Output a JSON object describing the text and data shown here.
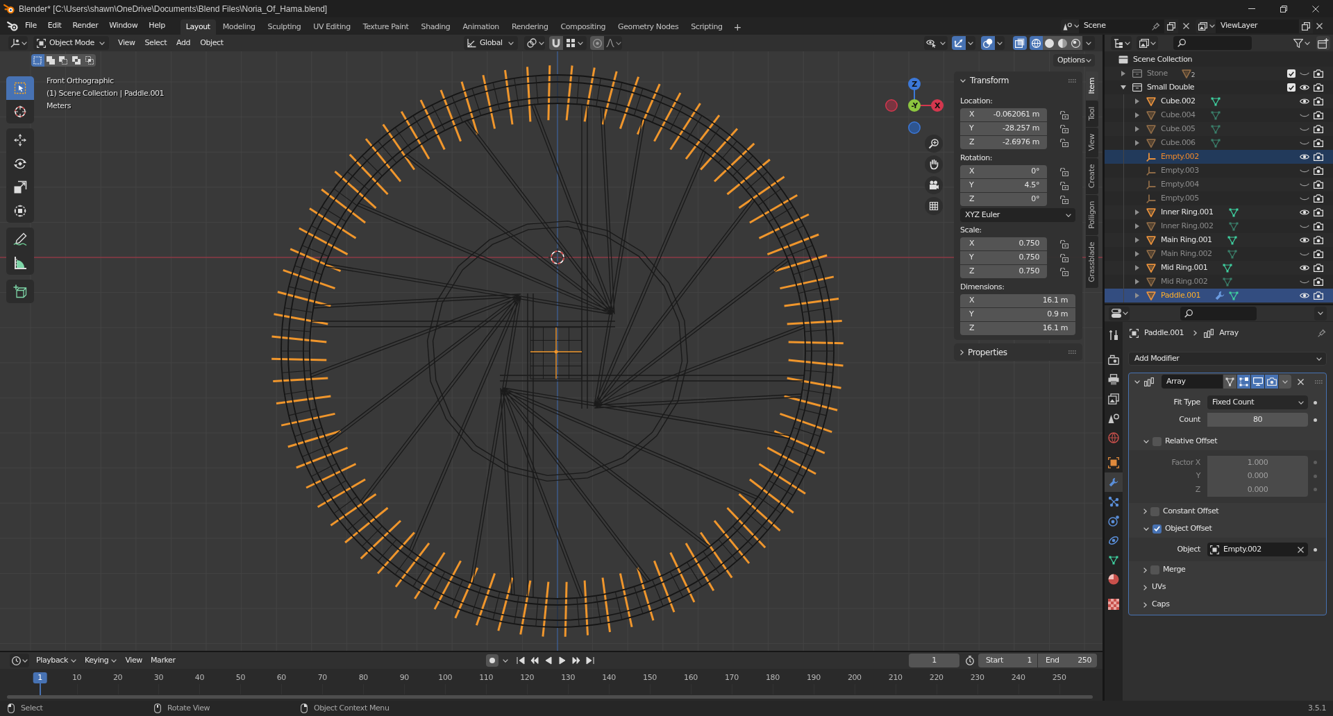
{
  "window": {
    "title": "Blender* [C:\\Users\\shawn\\OneDrive\\Documents\\Blend Files\\Noria_Of_Hama.blend]"
  },
  "top_bar": {
    "menus": [
      "File",
      "Edit",
      "Render",
      "Window",
      "Help"
    ],
    "workspaces": [
      {
        "label": "Layout",
        "selected": true
      },
      {
        "label": "Modeling",
        "selected": false
      },
      {
        "label": "Sculpting",
        "selected": false
      },
      {
        "label": "UV Editing",
        "selected": false
      },
      {
        "label": "Texture Paint",
        "selected": false
      },
      {
        "label": "Shading",
        "selected": false
      },
      {
        "label": "Animation",
        "selected": false
      },
      {
        "label": "Rendering",
        "selected": false
      },
      {
        "label": "Compositing",
        "selected": false
      },
      {
        "label": "Geometry Nodes",
        "selected": false
      },
      {
        "label": "Scripting",
        "selected": false
      }
    ],
    "add_workspace": "+",
    "scene": "Scene",
    "view_layer": "ViewLayer"
  },
  "viewport": {
    "mode": "Object Mode",
    "menus": [
      "View",
      "Select",
      "Add",
      "Object"
    ],
    "orientation": "Global",
    "overlay_toggles": [
      {
        "kind": "visibility",
        "on": false
      },
      {
        "kind": "gizmos",
        "on": true
      },
      {
        "kind": "overlays",
        "on": true
      },
      {
        "kind": "xray",
        "on": true
      }
    ],
    "shading": [
      {
        "kind": "wireframe",
        "selected": true
      },
      {
        "kind": "solid",
        "selected": false
      },
      {
        "kind": "material",
        "selected": false
      },
      {
        "kind": "rendered",
        "selected": false
      }
    ],
    "select_modes": [
      {
        "kind": "set",
        "selected": true
      },
      {
        "kind": "extend",
        "selected": false
      },
      {
        "kind": "subtract",
        "selected": false
      },
      {
        "kind": "invert",
        "selected": false
      },
      {
        "kind": "intersect",
        "selected": false
      }
    ],
    "options": "Options",
    "tools": [
      {
        "kind": "select_box",
        "selected": true
      },
      {
        "kind": "cursor",
        "selected": false
      },
      {
        "kind": "move",
        "selected": false
      },
      {
        "kind": "rotate",
        "selected": false
      },
      {
        "kind": "scale",
        "selected": false
      },
      {
        "kind": "transform",
        "selected": false
      },
      {
        "kind": "annotate",
        "selected": false
      },
      {
        "kind": "measure",
        "selected": false
      },
      {
        "kind": "add_cube",
        "selected": false
      }
    ],
    "info": [
      "Front Orthographic",
      "(1) Scene Collection | Paddle.001",
      "Meters"
    ],
    "gizmo": {
      "up": "Z",
      "facing": "-Y",
      "right": "X"
    },
    "sidebar": {
      "tabs": [
        {
          "label": "Item",
          "selected": true
        },
        {
          "label": "Tool",
          "selected": false
        },
        {
          "label": "View",
          "selected": false
        },
        {
          "label": "Create",
          "selected": false
        },
        {
          "label": "Poliigon",
          "selected": false
        },
        {
          "label": "Grassblade",
          "selected": false
        }
      ],
      "transform": {
        "title": "Transform",
        "expanded": true,
        "location": {
          "label": "Location:",
          "rows": [
            {
              "axis": "X",
              "value": "-0.062061 m",
              "locked": false
            },
            {
              "axis": "Y",
              "value": "-28.257 m",
              "locked": false
            },
            {
              "axis": "Z",
              "value": "-2.6976 m",
              "locked": false
            }
          ]
        },
        "rotation": {
          "label": "Rotation:",
          "rows": [
            {
              "axis": "X",
              "value": "0°",
              "locked": false
            },
            {
              "axis": "Y",
              "value": "4.5°",
              "locked": false
            },
            {
              "axis": "Z",
              "value": "0°",
              "locked": false
            }
          ]
        },
        "rotation_mode": "XYZ Euler",
        "scale": {
          "label": "Scale:",
          "rows": [
            {
              "axis": "X",
              "value": "0.750",
              "locked": false
            },
            {
              "axis": "Y",
              "value": "0.750",
              "locked": false
            },
            {
              "axis": "Z",
              "value": "0.750",
              "locked": false
            }
          ]
        },
        "dimensions": {
          "label": "Dimensions:",
          "rows": [
            {
              "axis": "X",
              "value": "16.1 m"
            },
            {
              "axis": "Y",
              "value": "0.9 m"
            },
            {
              "axis": "Z",
              "value": "16.1 m"
            }
          ]
        }
      },
      "properties_panel": {
        "title": "Properties",
        "expanded": false
      }
    }
  },
  "outliner": {
    "root": {
      "label": "Scene Collection",
      "kind": "scene_collection",
      "children": [
        {
          "label": "Stone",
          "kind": "collection",
          "expanded": false,
          "checked": true,
          "visible": false,
          "selected": false,
          "count": "2"
        },
        {
          "label": "Small Double",
          "kind": "collection",
          "expanded": true,
          "checked": true,
          "visible": true,
          "selected": false,
          "children": [
            {
              "label": "Cube.002",
              "kind": "mesh",
              "expanded": false,
              "visible": true,
              "selected": false
            },
            {
              "label": "Cube.004",
              "kind": "mesh",
              "expanded": false,
              "visible": false,
              "selected": false
            },
            {
              "label": "Cube.005",
              "kind": "mesh",
              "expanded": false,
              "visible": false,
              "selected": false
            },
            {
              "label": "Cube.006",
              "kind": "mesh",
              "expanded": false,
              "visible": false,
              "selected": false
            },
            {
              "label": "Empty.002",
              "kind": "empty",
              "visible": true,
              "selected": true,
              "active": false
            },
            {
              "label": "Empty.003",
              "kind": "empty",
              "visible": false,
              "selected": false
            },
            {
              "label": "Empty.004",
              "kind": "empty",
              "visible": false,
              "selected": false
            },
            {
              "label": "Empty.005",
              "kind": "empty",
              "visible": false,
              "selected": false
            },
            {
              "label": "Inner Ring.001",
              "kind": "mesh",
              "expanded": false,
              "visible": true,
              "selected": false
            },
            {
              "label": "Inner Ring.002",
              "kind": "mesh",
              "expanded": false,
              "visible": false,
              "selected": false
            },
            {
              "label": "Main Ring.001",
              "kind": "mesh",
              "expanded": false,
              "visible": true,
              "selected": false
            },
            {
              "label": "Main Ring.002",
              "kind": "mesh",
              "expanded": false,
              "visible": false,
              "selected": false
            },
            {
              "label": "Mid Ring.001",
              "kind": "mesh",
              "expanded": false,
              "visible": true,
              "selected": false
            },
            {
              "label": "Mid Ring.002",
              "kind": "mesh",
              "expanded": false,
              "visible": false,
              "selected": false
            },
            {
              "label": "Paddle.001",
              "kind": "mesh",
              "expanded": false,
              "visible": true,
              "selected": true,
              "active": true,
              "modifier": true
            }
          ]
        }
      ]
    }
  },
  "properties": {
    "tabs": [
      {
        "kind": "tool",
        "selected": false
      },
      {
        "kind": "render",
        "selected": false
      },
      {
        "kind": "output",
        "selected": false
      },
      {
        "kind": "view_layer",
        "selected": false
      },
      {
        "kind": "scene",
        "selected": false
      },
      {
        "kind": "world",
        "selected": false
      },
      {
        "kind": "object",
        "selected": false
      },
      {
        "kind": "modifiers",
        "selected": true
      },
      {
        "kind": "particles",
        "selected": false
      },
      {
        "kind": "physics",
        "selected": false
      },
      {
        "kind": "constraints",
        "selected": false
      },
      {
        "kind": "data",
        "selected": false
      },
      {
        "kind": "material",
        "selected": false
      },
      {
        "kind": "texture",
        "selected": false
      }
    ],
    "context": {
      "object": "Paddle.001",
      "modifier": "Array"
    },
    "add_modifier": "Add Modifier",
    "modifier": {
      "name": "Array",
      "expanded": true,
      "active": true,
      "toggles": [
        {
          "kind": "cage",
          "on": false
        },
        {
          "kind": "edit_mode",
          "on": true
        },
        {
          "kind": "viewport",
          "on": true
        },
        {
          "kind": "render",
          "on": true
        }
      ],
      "fields": [
        {
          "label": "Fit Type",
          "kind": "dropdown",
          "value": "Fixed Count"
        },
        {
          "label": "Count",
          "kind": "number",
          "value": "80"
        }
      ],
      "sections": [
        {
          "label": "Relative Offset",
          "checked": false,
          "expanded": true,
          "fields": [
            {
              "label": "Factor X",
              "kind": "number",
              "value": "1.000"
            },
            {
              "label": "Y",
              "kind": "number",
              "value": "0.000"
            },
            {
              "label": "Z",
              "kind": "number",
              "value": "0.000"
            }
          ]
        },
        {
          "label": "Constant Offset",
          "checked": false,
          "expanded": false
        },
        {
          "label": "Object Offset",
          "checked": true,
          "expanded": true,
          "fields": [
            {
              "label": "Object",
              "kind": "object",
              "value": "Empty.002"
            }
          ]
        },
        {
          "label": "Merge",
          "checked": false,
          "expanded": false
        },
        {
          "label": "UVs",
          "expanded": false
        },
        {
          "label": "Caps",
          "expanded": false
        }
      ]
    }
  },
  "timeline": {
    "menus": [
      {
        "label": "Playback",
        "kind": "dropdown"
      },
      {
        "label": "Keying",
        "kind": "dropdown"
      },
      {
        "label": "View",
        "kind": "menu"
      },
      {
        "label": "Marker",
        "kind": "menu"
      }
    ],
    "current_frame": "1",
    "start": {
      "label": "Start",
      "value": "1"
    },
    "end": {
      "label": "End",
      "value": "250"
    },
    "playhead": "1",
    "ruler": [
      "10",
      "20",
      "30",
      "40",
      "50",
      "60",
      "70",
      "80",
      "90",
      "100",
      "110",
      "120",
      "130",
      "140",
      "150",
      "160",
      "170",
      "180",
      "190",
      "200",
      "210",
      "220",
      "230",
      "240",
      "250"
    ]
  },
  "status_bar": {
    "hints": [
      {
        "kind": "left",
        "label": "Select"
      },
      {
        "kind": "middle",
        "label": "Rotate View"
      },
      {
        "kind": "right",
        "label": "Object Context Menu"
      }
    ],
    "version": "3.5.1"
  }
}
